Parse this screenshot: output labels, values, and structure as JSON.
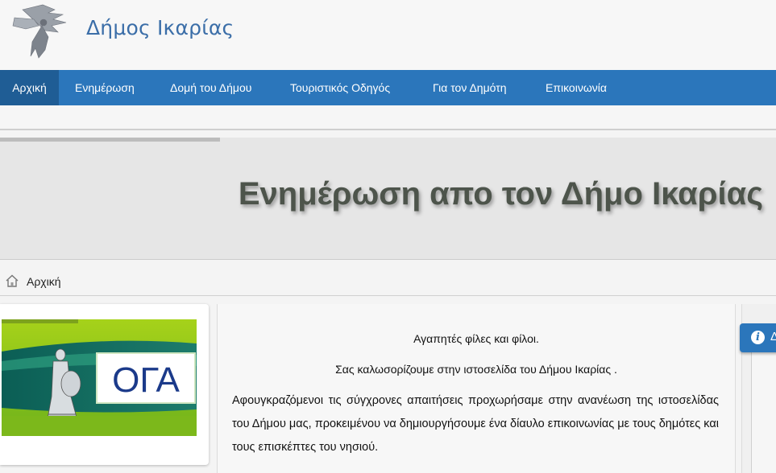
{
  "header": {
    "site_title": "Δήμος Ικαρίας"
  },
  "nav": {
    "items": [
      {
        "label": "Αρχική",
        "active": true
      },
      {
        "label": "Ενημέρωση"
      },
      {
        "label": "Δομή του Δήμου"
      },
      {
        "label": "Τουριστικός Οδηγός"
      },
      {
        "label": "Για τον Δημότη"
      },
      {
        "label": "Επικοινωνία"
      }
    ]
  },
  "hero": {
    "title": "Ενημέρωση απο τον Δήμο Ικαρίας"
  },
  "breadcrumb": {
    "home_label": "Αρχική"
  },
  "left_panel": {
    "banner_text": "ΟΓΑ"
  },
  "main": {
    "greeting1": "Αγαπητές φίλες και φίλοι.",
    "greeting2": "Σας καλωσορίζουμε στην ιστοσελίδα του Δήμου Ικαρίας .",
    "paragraph": "Αφουγκραζόμενοι τις σύγχρονες απαιτήσεις προχωρήσαμε στην ανανέωση της ιστοσελίδας του Δήμου μας, προκειμένου να δημιουργήσουμε ένα δίαυλο επικοινωνίας με τους δημότες και τους επισκέπτες του νησιού."
  },
  "widget": {
    "info_icon": "info-icon",
    "tab_text": "Δ"
  },
  "colors": {
    "nav_bg": "#2b76bb",
    "nav_active": "#1f5d95",
    "title_blue": "#3b6ea8",
    "hero_text": "#4d544b"
  }
}
